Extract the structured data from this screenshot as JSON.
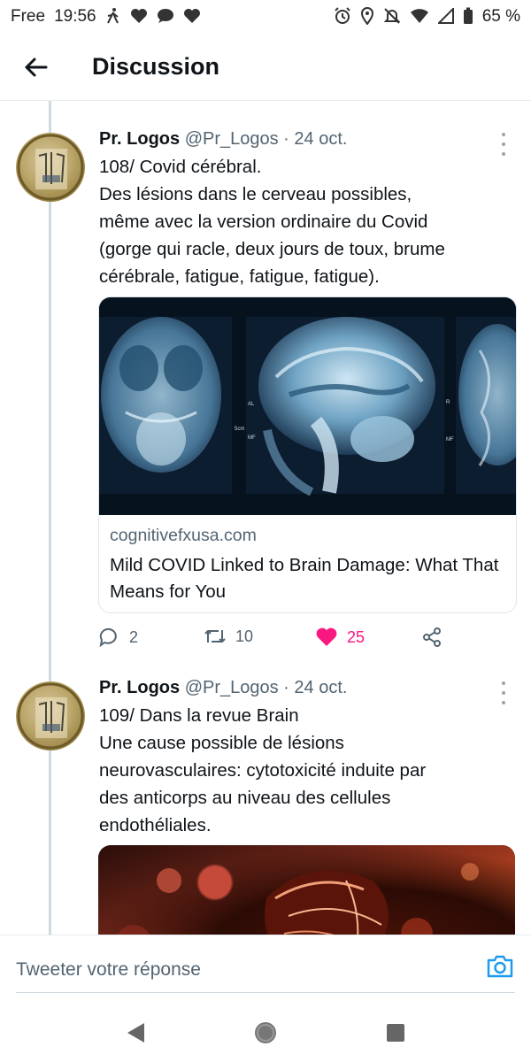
{
  "status_bar": {
    "carrier": "Free",
    "time": "19:56",
    "battery": "65 %",
    "left_icons": [
      "walk-icon",
      "heart-icon",
      "chat-bubble-icon",
      "heart-icon"
    ],
    "right_icons": [
      "alarm-icon",
      "location-icon",
      "mute-icon",
      "wifi-icon",
      "signal-icon",
      "battery-icon"
    ]
  },
  "header": {
    "title": "Discussion",
    "back_icon": "arrow-left-icon"
  },
  "tweets": [
    {
      "name": "Pr. Logos",
      "handle": "@Pr_Logos",
      "date": "· 24 oct.",
      "lines": [
        "108/ Covid cérébral.",
        "Des lésions dans le cerveau possibles,",
        "même avec la version ordinaire du Covid",
        "(gorge qui racle, deux jours de toux, brume",
        "cérébrale, fatigue, fatigue, fatigue)."
      ],
      "card": {
        "domain": "cognitivefxusa.com",
        "title": "Mild COVID Linked to Brain Damage: What That Means for You",
        "scan_labels": {
          "a": "AL",
          "b": "5cm",
          "c": "MF",
          "d": "R",
          "e": "MF"
        }
      },
      "actions": {
        "replies": "2",
        "retweets": "10",
        "likes": "25"
      }
    },
    {
      "name": "Pr. Logos",
      "handle": "@Pr_Logos",
      "date": "· 24 oct.",
      "lines": [
        "109/ Dans la revue Brain",
        "Une cause possible de lésions",
        "neurovasculaires:  cytotoxicité induite par",
        "des anticorps au niveau des cellules",
        "endothéliales."
      ]
    }
  ],
  "reply": {
    "placeholder": "Tweeter votre réponse"
  },
  "colors": {
    "like": "#f91880",
    "link_blue": "#1d9bf0",
    "secondary_text": "#536471"
  }
}
